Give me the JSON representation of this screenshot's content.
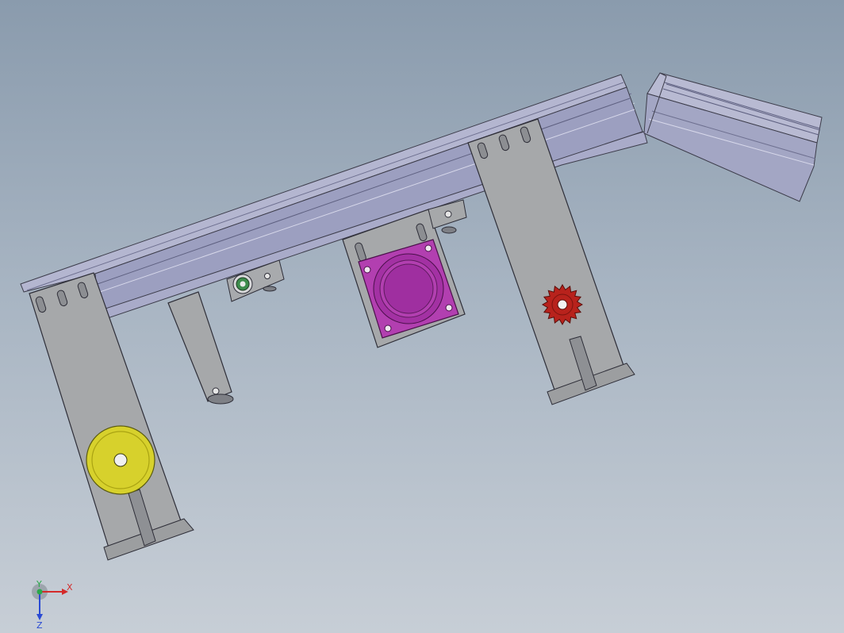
{
  "viewport": {
    "background_top": "#8a9bad",
    "background_bottom": "#c7ced6"
  },
  "model": {
    "colors": {
      "frame": "#9fa2c3",
      "frame_dark": "#7f82a6",
      "plate": "#a3a5a7",
      "plate_edge": "#3c3c48",
      "pulley": "#d9d42a",
      "pulley_rim": "#b9b214",
      "motor": "#b23fb0",
      "motor_inner": "#8e2c8e",
      "gear": "#b8221c",
      "bearing": "#3c8b4b"
    },
    "components": [
      "aluminum-profile-frame",
      "angled-frame-section",
      "left-support-plate",
      "right-support-plate",
      "drive-pulley",
      "tension-arm",
      "bearing-block",
      "motor-mount-plate",
      "stepper-motor",
      "drive-gear"
    ]
  },
  "triad": {
    "x_label": "X",
    "y_label": "Y",
    "z_label": "Z",
    "x_color": "#d42a2a",
    "y_color": "#2aa84a",
    "z_color": "#2a4ad4"
  }
}
